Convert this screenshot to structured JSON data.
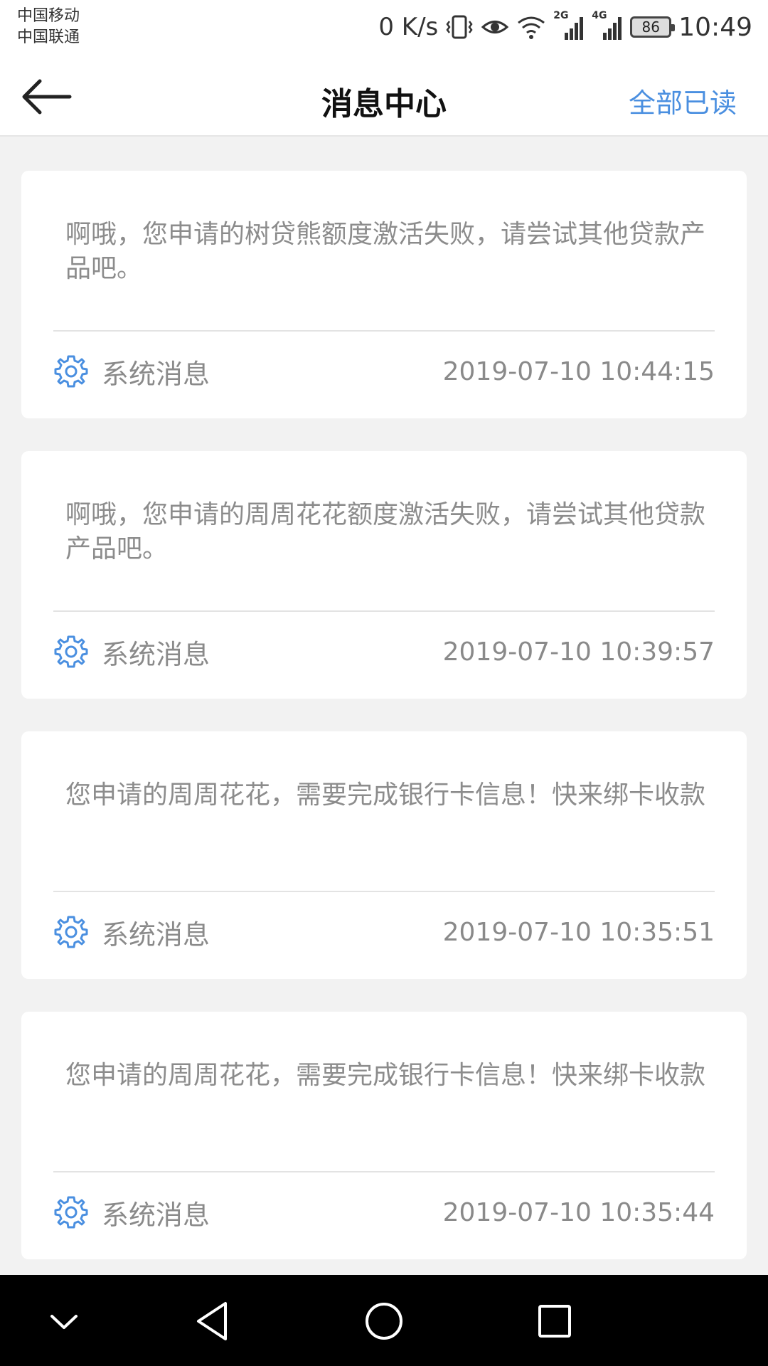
{
  "status_bar": {
    "carrier_1": "中国移动",
    "carrier_2": "中国联通",
    "net_speed": "0 K/s",
    "signal_1_label": "2G",
    "signal_2_label": "4G",
    "battery": "86",
    "time": "10:49"
  },
  "header": {
    "title": "消息中心",
    "mark_all_read": "全部已读"
  },
  "messages": [
    {
      "text": "啊哦，您申请的树贷熊额度激活失败，请尝试其他贷款产品吧。",
      "type": "系统消息",
      "time": "2019-07-10 10:44:15"
    },
    {
      "text": "啊哦，您申请的周周花花额度激活失败，请尝试其他贷款产品吧。",
      "type": "系统消息",
      "time": "2019-07-10 10:39:57"
    },
    {
      "text": "您申请的周周花花，需要完成银行卡信息！快来绑卡收款",
      "type": "系统消息",
      "time": "2019-07-10 10:35:51"
    },
    {
      "text": "您申请的周周花花，需要完成银行卡信息！快来绑卡收款",
      "type": "系统消息",
      "time": "2019-07-10 10:35:44"
    }
  ],
  "colors": {
    "accent": "#4a8fe0",
    "icon_blue": "#4a8fe0"
  }
}
